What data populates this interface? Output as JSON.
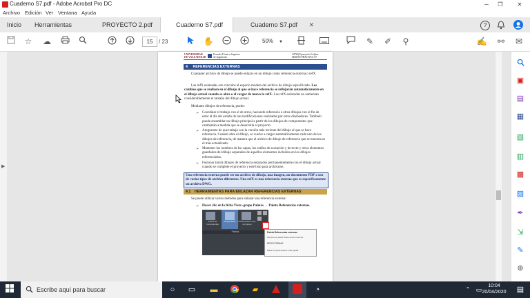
{
  "window": {
    "title": "Cuaderno S7.pdf - Adobe Acrobat Pro DC",
    "minimize": "─",
    "restore": "❐",
    "close": "✕"
  },
  "menu": [
    "Archivo",
    "Edición",
    "Ver",
    "Ventana",
    "Ayuda"
  ],
  "tabs": {
    "home": "Inicio",
    "tools": "Herramientas",
    "docs": [
      {
        "label": "PROYECTO 2.pdf",
        "close": "✕"
      },
      {
        "label": "Cuaderno S7.pdf",
        "close": "✕"
      },
      {
        "label": "Cuaderno S7.pdf",
        "close": "✕"
      }
    ],
    "help_icon": "?",
    "bell_icon": "🔔"
  },
  "toolbar": {
    "page_current": "15",
    "page_total": "/ 23",
    "zoom": "50%"
  },
  "document": {
    "header_left": "UNIVERSIDAD\nDE VALLADOLID",
    "header_mid": "Escuela Técnica Superior\nde Ingeniería",
    "header_right": "34760 Expresión Gráfica\nSESIÓN PRÁCTICA S7",
    "section4_num": "4",
    "section4_title": "REFERENCIAS EXTERNAS",
    "p1": "Cualquier archivo de dibujo se puede enlazar en un dibujo como referencia externa o refX.",
    "p2a": "Las refX enlazadas son vínculos al espacio modelo del archivo de dibujo especificado.",
    "p2b": "Los cambios que se realicen en el dibujo al que se hace referencia se reflejarán automáticamente en el dibujo actual cuando se abra o al cargar de nuevo la refX.",
    "p2c": "Las refX enlazadas no aumentan considerablemente el tamaño del dibujo actual.",
    "p3": "Mediante dibujos de referencia, puede:",
    "bullets": [
      "Coordinar el trabajo con el de otros, haciendo referencia a otros dibujos con el fin de estar al día del estado de las modificaciones realizadas por otros diseñadores. También puede ensamblar un dibujo principal a partir de los dibujos de componentes que cambiarán a medida que se desarrolla el proyecto.",
      "Asegurarse de que trabaja con la versión más reciente del dibujo al que se hace referencia. Cuando abre el dibujo, se vuelve a cargar automáticamente cada uno de los dibujos de referencia, de manera que el archivo de dibujo de referencia que se muestra es el más actualizado.",
      "Mantener los nombres de las capas, los estilos de acotación y de texto y otros elementos guardados del dibujo separados de aquellos elementos incluidos en los dibujos referenciados.",
      "Fusionar (unir) dibujos de referencia enlazados permanentemente con el dibujo actual cuando se complete el proyecto y esté listo para archivarse."
    ],
    "bullet_mark": "➢",
    "note": "Una referencia externa puede ser un archivo de dibujo, una imagen, un documento PDF o uso de varios tipos de archivo diferentes. Una refX es una referencia externa que es específicamente un archivo DWG.",
    "section41_num": "4.1",
    "section41_title": "HERRAMIENTAS PARA ENLAZAR REFERENCIAS EXTERNAS",
    "p4": "Se puede utilizar varios métodos para enlazar una referencia externa:",
    "step": "Hacer clic en la ficha Vista ›grupo Paletas → Paleta Referencias externas.",
    "shot": {
      "btn1": "Paleta de herramientas",
      "btn2": "Propiedades",
      "btn3": "Administrador conj. de planos",
      "group": "Paletas",
      "menu1": "Paleta Referencias externas",
      "menu2": "Muestra la paleta Referencias externas",
      "menu3": "REFEXTERNAS",
      "menu4": "Pulse F1 para obtener más ayuda"
    }
  },
  "taskbar": {
    "search_placeholder": "Escribe aquí para buscar",
    "time": "10:04",
    "date": "20/04/2020"
  },
  "colors": {
    "section_blue": "#2c4f8f",
    "section_gold": "#c9a24a",
    "note_bg": "#dfe6f5",
    "acrobat_red": "#d4201d"
  }
}
